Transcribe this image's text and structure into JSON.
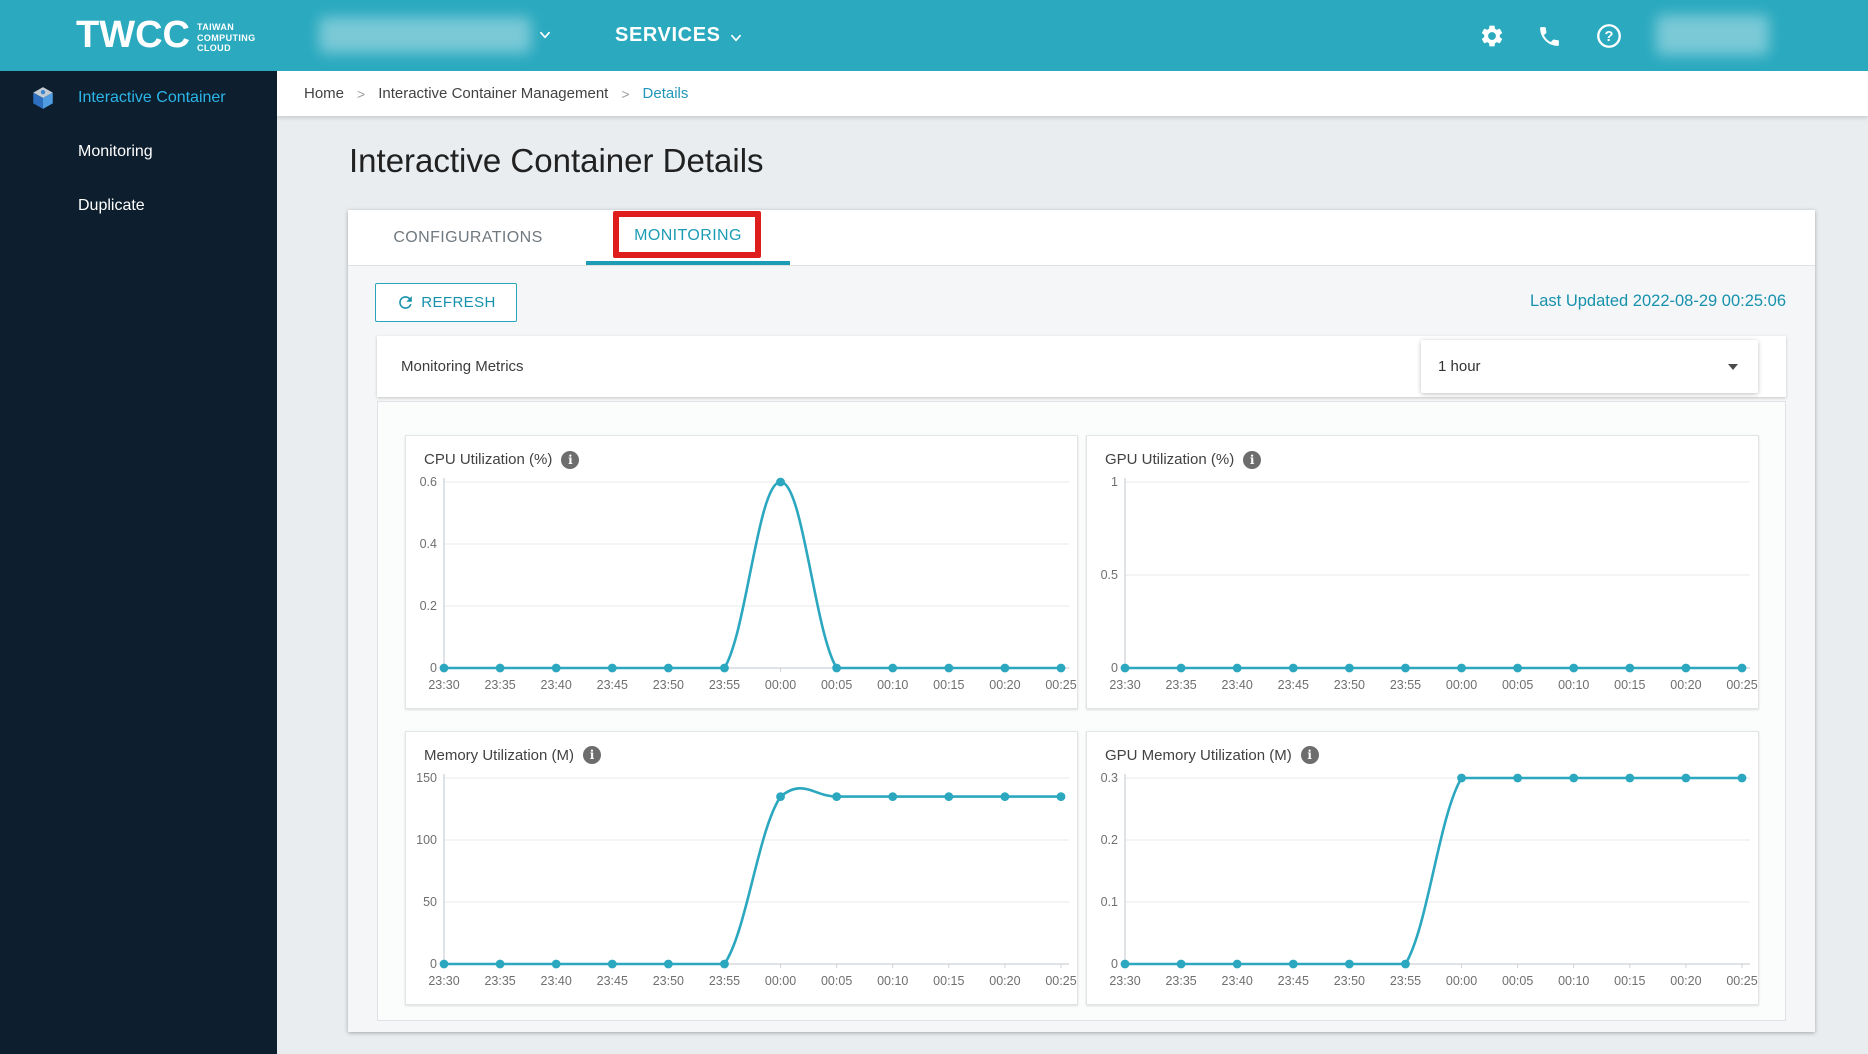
{
  "header": {
    "brand": "TWCC",
    "tagline": "TAIWAN\nCOMPUTING\nCLOUD",
    "services_label": "SERVICES"
  },
  "sidebar": {
    "items": [
      {
        "label": "Interactive Container",
        "active": true,
        "icon": "container-cube"
      },
      {
        "label": "Monitoring",
        "active": false
      },
      {
        "label": "Duplicate",
        "active": false
      }
    ]
  },
  "breadcrumb": {
    "items": [
      {
        "label": "Home",
        "current": false
      },
      {
        "label": "Interactive Container Management",
        "current": false
      },
      {
        "label": "Details",
        "current": true
      }
    ]
  },
  "page": {
    "title": "Interactive Container Details"
  },
  "tabs": [
    {
      "label": "CONFIGURATIONS",
      "active": false
    },
    {
      "label": "MONITORING",
      "active": true
    }
  ],
  "toolbar": {
    "refresh_label": "REFRESH",
    "last_updated": "Last Updated 2022-08-29 00:25:06"
  },
  "metrics": {
    "label": "Monitoring Metrics",
    "range_selected": "1 hour"
  },
  "colors": {
    "header_teal": "#2aa9bf",
    "sidebar_navy": "#0d1e2e",
    "accent_teal": "#1d9cb5",
    "link_teal": "#2196b8",
    "chart_line": "#2ba7bf",
    "annotation_red": "#e01d1d"
  },
  "chart_data": [
    {
      "type": "line",
      "title": "CPU Utilization (%)",
      "x": [
        "23:30",
        "23:35",
        "23:40",
        "23:45",
        "23:50",
        "23:55",
        "00:00",
        "00:05",
        "00:10",
        "00:15",
        "00:20",
        "00:25"
      ],
      "values": [
        0,
        0,
        0,
        0,
        0,
        0,
        0.6,
        0,
        0,
        0,
        0,
        0
      ],
      "yticks": [
        0,
        0.2,
        0.4,
        0.6
      ],
      "ylim": [
        0,
        0.6
      ],
      "grid": true,
      "legend": "none",
      "line_color": "#2ba7bf"
    },
    {
      "type": "line",
      "title": "GPU Utilization (%)",
      "x": [
        "23:30",
        "23:35",
        "23:40",
        "23:45",
        "23:50",
        "23:55",
        "00:00",
        "00:05",
        "00:10",
        "00:15",
        "00:20",
        "00:25"
      ],
      "values": [
        0,
        0,
        0,
        0,
        0,
        0,
        0,
        0,
        0,
        0,
        0,
        0
      ],
      "yticks": [
        0,
        0.5,
        1
      ],
      "ylim": [
        0,
        1
      ],
      "grid": true,
      "legend": "none",
      "line_color": "#2ba7bf"
    },
    {
      "type": "line",
      "title": "Memory Utilization (M)",
      "x": [
        "23:30",
        "23:35",
        "23:40",
        "23:45",
        "23:50",
        "23:55",
        "00:00",
        "00:05",
        "00:10",
        "00:15",
        "00:20",
        "00:25"
      ],
      "values": [
        0,
        0,
        0,
        0,
        0,
        0,
        135,
        135,
        135,
        135,
        135,
        135
      ],
      "yticks": [
        0,
        50,
        100,
        150
      ],
      "ylim": [
        0,
        150
      ],
      "grid": true,
      "legend": "none",
      "line_color": "#2ba7bf"
    },
    {
      "type": "line",
      "title": "GPU Memory Utilization (M)",
      "x": [
        "23:30",
        "23:35",
        "23:40",
        "23:45",
        "23:50",
        "23:55",
        "00:00",
        "00:05",
        "00:10",
        "00:15",
        "00:20",
        "00:25"
      ],
      "values": [
        0,
        0,
        0,
        0,
        0,
        0,
        0.3,
        0.3,
        0.3,
        0.3,
        0.3,
        0.3
      ],
      "yticks": [
        0,
        0.1,
        0.2,
        0.3
      ],
      "ylim": [
        0,
        0.3
      ],
      "grid": true,
      "legend": "none",
      "line_color": "#2ba7bf"
    }
  ]
}
